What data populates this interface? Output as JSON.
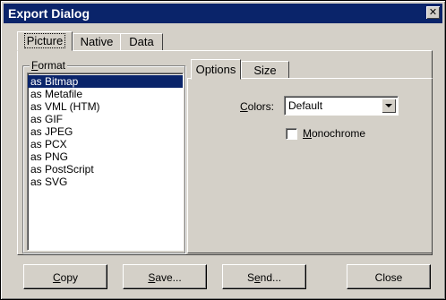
{
  "window": {
    "title": "Export Dialog",
    "close_glyph": "✕"
  },
  "outer_tabs": [
    {
      "label": "Picture",
      "active": true
    },
    {
      "label": "Native",
      "active": false
    },
    {
      "label": "Data",
      "active": false
    }
  ],
  "format_group": {
    "legend_first": "F",
    "legend_rest": "ormat",
    "items": [
      {
        "label": "as Bitmap",
        "selected": true
      },
      {
        "label": "as Metafile"
      },
      {
        "label": "as VML (HTM)"
      },
      {
        "label": "as GIF"
      },
      {
        "label": "as JPEG"
      },
      {
        "label": "as PCX"
      },
      {
        "label": "as PNG"
      },
      {
        "label": "as PostScript"
      },
      {
        "label": "as SVG"
      }
    ]
  },
  "inner_tabs": [
    {
      "label": "Options",
      "active": true
    },
    {
      "label": "Size",
      "active": false
    }
  ],
  "options": {
    "colors_label_first": "C",
    "colors_label_rest": "olors:",
    "colors_value": "Default",
    "monochrome_label_first": "M",
    "monochrome_label_rest": "onochrome",
    "monochrome_checked": false
  },
  "buttons": {
    "copy_first": "C",
    "copy_rest": "opy",
    "save_first": "S",
    "save_rest": "ave...",
    "send_pre": "S",
    "send_underlined": "e",
    "send_rest": "nd...",
    "close_label": "Close"
  },
  "colors": {
    "titlebar": "#0a246a",
    "face": "#d4d0c8",
    "selection": "#0a246a"
  },
  "icons": {
    "close": "close-icon",
    "dropdown": "chevron-down-icon"
  }
}
